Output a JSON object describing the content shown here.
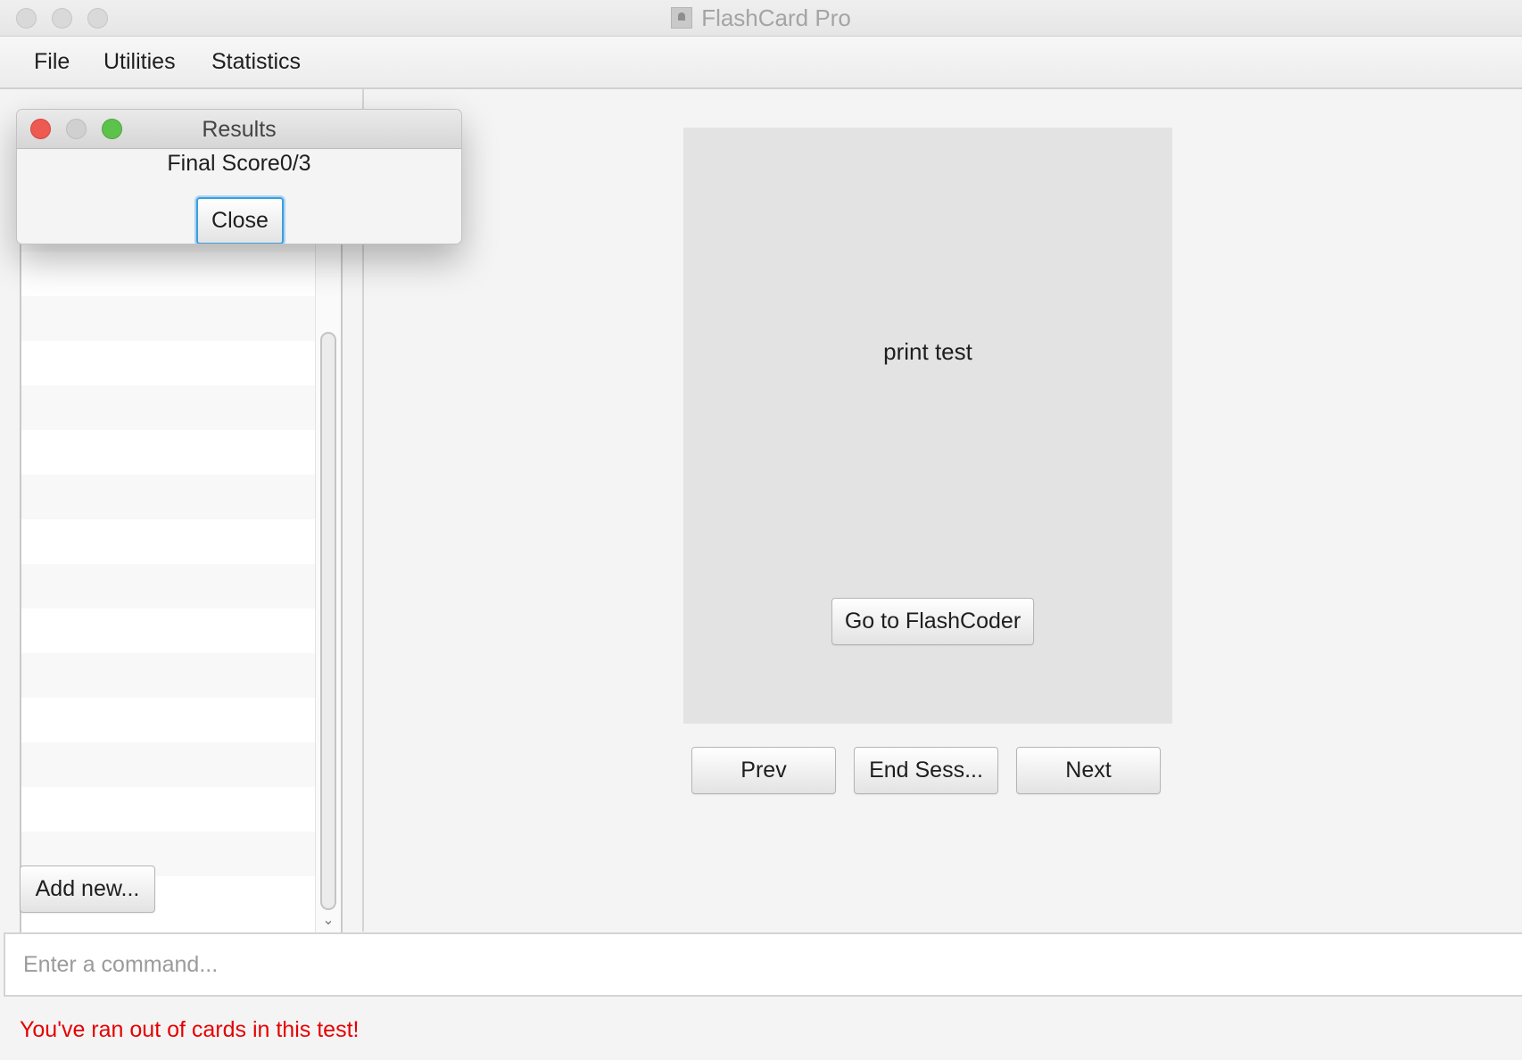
{
  "window": {
    "title": "FlashCard Pro",
    "icon": "app-icon"
  },
  "menu": {
    "items": [
      "File",
      "Utilities",
      "Statistics"
    ]
  },
  "sidebar": {
    "add_button": "Add new..."
  },
  "card": {
    "text": "print test",
    "goto_button": "Go to FlashCoder"
  },
  "navigation": {
    "prev": "Prev",
    "end_session": "End Sess...",
    "next": "Next"
  },
  "command": {
    "placeholder": "Enter a command...",
    "value": ""
  },
  "status": {
    "message": "You've ran out of cards in this test!",
    "color": "#e60000"
  },
  "dialog": {
    "title": "Results",
    "score_label": "Final Score0/3",
    "close_button": "Close",
    "colors": {
      "close": "#ee5a52",
      "minimize": "#d0d0d0",
      "maximize": "#5dc24c"
    }
  }
}
